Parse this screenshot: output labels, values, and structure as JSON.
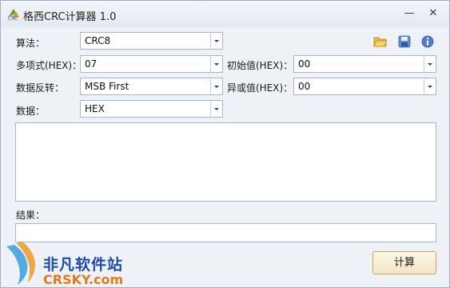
{
  "window": {
    "title": "格西CRC计算器 1.0",
    "minimize_glyph": "—",
    "close_glyph": "✕"
  },
  "form": {
    "algorithm_label": "算法：",
    "algorithm_value": "CRC8",
    "polynomial_label": "多项式(HEX)：",
    "polynomial_value": "07",
    "init_label": "初始值(HEX)：",
    "init_value": "00",
    "reflect_label": "数据反转：",
    "reflect_value": "MSB First",
    "xor_label": "异或值(HEX)：",
    "xor_value": "00",
    "data_label": "数据：",
    "data_format_value": "HEX",
    "result_label": "结果：",
    "calculate_button": "计算"
  },
  "toolbar": {
    "icons": [
      "open-folder-icon",
      "save-icon",
      "info-icon"
    ]
  },
  "watermark": {
    "line1": "非凡软件站",
    "line2": "CRSKY.com"
  }
}
